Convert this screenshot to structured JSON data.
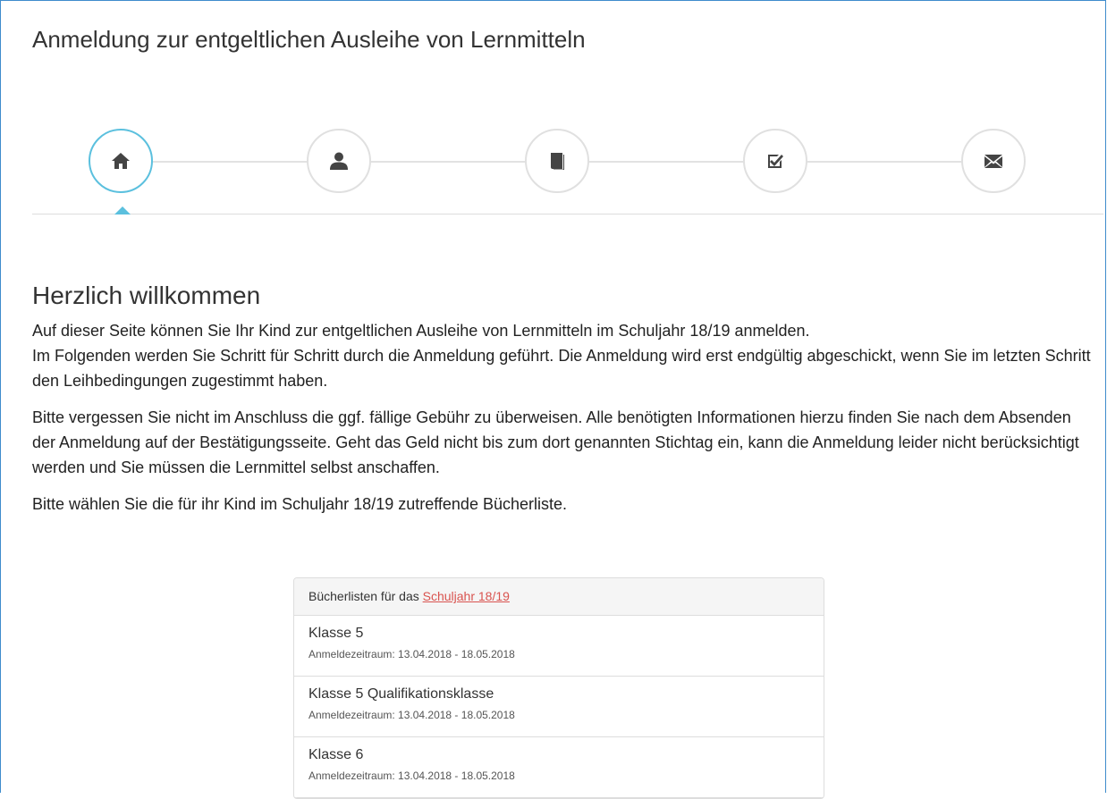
{
  "page": {
    "title": "Anmeldung zur entgeltlichen Ausleihe von Lernmitteln"
  },
  "wizard": {
    "steps": [
      {
        "icon": "home-icon",
        "active": true
      },
      {
        "icon": "user-icon",
        "active": false
      },
      {
        "icon": "book-icon",
        "active": false
      },
      {
        "icon": "checkbox-icon",
        "active": false
      },
      {
        "icon": "envelope-icon",
        "active": false
      }
    ],
    "accent_color": "#5bc0de"
  },
  "welcome": {
    "heading": "Herzlich willkommen",
    "paragraph1_line1": "Auf dieser Seite können Sie Ihr Kind zur entgeltlichen Ausleihe von Lernmitteln im Schuljahr 18/19 anmelden.",
    "paragraph1_line2": "Im Folgenden werden Sie Schritt für Schritt durch die Anmeldung geführt. Die Anmeldung wird erst endgültig abgeschickt, wenn Sie im letzten Schritt den Leihbedingungen zugestimmt haben.",
    "paragraph2": "Bitte vergessen Sie nicht im Anschluss die ggf. fällige Gebühr zu überweisen. Alle benötigten Informationen hierzu finden Sie nach dem Absenden der Anmeldung auf der Bestätigungsseite. Geht das Geld nicht bis zum dort genannten Stichtag ein, kann die Anmeldung leider nicht berücksichtigt werden und Sie müssen die Lernmittel selbst anschaffen.",
    "paragraph3": "Bitte wählen Sie die für ihr Kind im Schuljahr 18/19 zutreffende Bücherliste."
  },
  "booklists": {
    "heading_prefix": "Bücherlisten für das",
    "heading_link": "Schuljahr 18/19",
    "link_color": "#d9534f",
    "items": [
      {
        "name": "Klasse 5",
        "period": "Anmeldezeitraum: 13.04.2018 - 18.05.2018"
      },
      {
        "name": "Klasse 5 Qualifikationsklasse",
        "period": "Anmeldezeitraum: 13.04.2018 - 18.05.2018"
      },
      {
        "name": "Klasse 6",
        "period": "Anmeldezeitraum: 13.04.2018 - 18.05.2018"
      }
    ]
  }
}
